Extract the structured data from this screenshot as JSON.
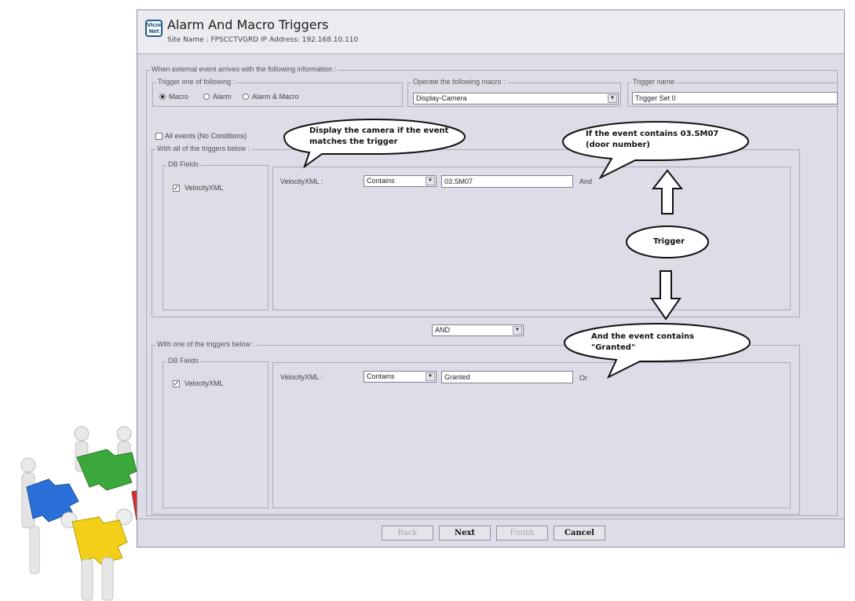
{
  "window": {
    "logo_text": "Vicon Net",
    "title": "Alarm And Macro Triggers",
    "site_line": "Site Name : FPSCCTVGRD   IP Address: 192.168.10.110"
  },
  "outer_group": {
    "legend": "When external event arrives with the following information :"
  },
  "trigger_type": {
    "legend": "Trigger one of following :",
    "options": [
      {
        "label": "Macro",
        "selected": true
      },
      {
        "label": "Alarm",
        "selected": false
      },
      {
        "label": "Alarm & Macro",
        "selected": false
      }
    ]
  },
  "macro": {
    "legend": "Operate the following macro :",
    "value": "Display-Camera"
  },
  "trigger_name": {
    "legend": "Trigger name",
    "value": "Trigger Set 0"
  },
  "all_events": {
    "label": "All events (No Conditions)",
    "checked": false
  },
  "group_all": {
    "legend": "With all of the triggers below :",
    "db_legend": "DB Fields",
    "db_field": {
      "label": "VelocityXML",
      "checked": true
    },
    "row": {
      "field": "VelocityXML :",
      "operator": "Contains",
      "value": "03.SM07",
      "conjunction": "And"
    }
  },
  "combinator": {
    "value": "AND"
  },
  "group_one": {
    "legend": "With one of the triggers below :",
    "db_legend": "DB Fields",
    "db_field": {
      "label": "VelocityXML",
      "checked": true
    },
    "row": {
      "field": "VelocityXML :",
      "operator": "Contains",
      "value": "Granted",
      "conjunction": "Or"
    }
  },
  "buttons": {
    "back": "Back",
    "next": "Next",
    "finish": "Finish",
    "cancel": "Cancel"
  },
  "annotations": {
    "display_camera": "Display the camera if the event\nmatches the trigger",
    "event_door": "If the event contains 03.SM07\n(door number)",
    "trigger": "Trigger",
    "event_granted": "And the event contains\n\"Granted\""
  },
  "icons": {
    "checkmark": "checkmark-icon",
    "dropdown": "chevron-down-icon",
    "arrows": "outline-arrow-icon"
  }
}
